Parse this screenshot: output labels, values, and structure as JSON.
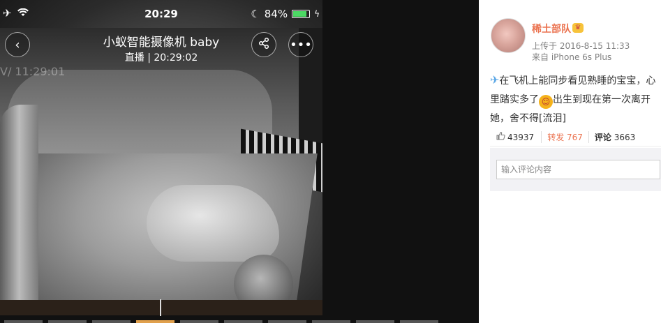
{
  "status_bar": {
    "time": "20:29",
    "battery_percent": "84%",
    "battery_level": 0.84
  },
  "camera": {
    "title": "小蚁智能摄像机 baby",
    "subtitle": "直播 | 20:29:02",
    "overlay_time": "V/ 11:29:01"
  },
  "post": {
    "username": "稀土部队",
    "upload_time": "上传于 2016-8-15 11:33",
    "source": "来自 iPhone 6s Plus",
    "text_part1": "在飞机上能同步看见熟睡的宝宝，心里踏实多了",
    "text_part2": "出生到现在第一次离开她，舍不得[流泪]",
    "likes": "43937",
    "repost": "转发 767",
    "comment_label": "评论",
    "comment_count": "3663",
    "comment_placeholder": "输入评论内容"
  },
  "icons": {
    "airplane": "airplane-icon",
    "wifi": "wifi-icon",
    "moon": "moon-icon",
    "battery": "battery-icon",
    "charging": "charging-icon",
    "back": "chevron-left-icon",
    "share": "share-icon",
    "more": "more-icon",
    "like": "thumbs-up-icon",
    "vip": "vip-badge-icon",
    "plane_emoji": "plane-emoji-icon",
    "face_emoji": "face-emoji-icon"
  },
  "colors": {
    "accent": "#eb7350",
    "battery_green": "#4cd964",
    "link_blue": "#5aa7e6"
  }
}
